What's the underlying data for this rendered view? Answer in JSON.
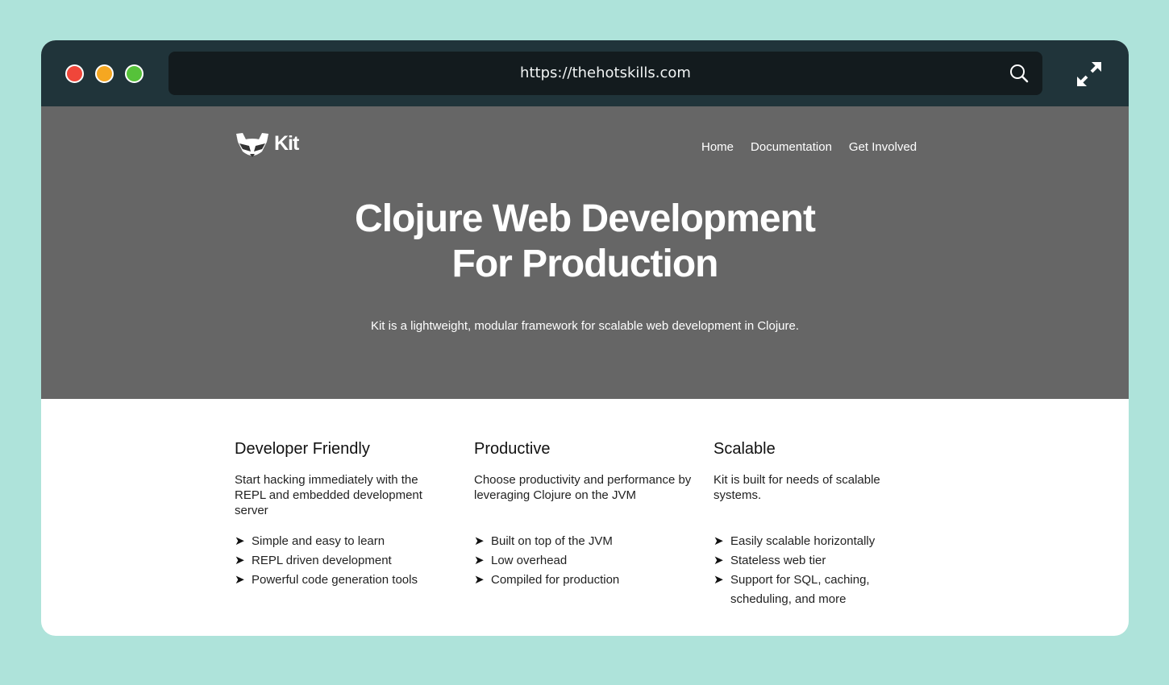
{
  "browser": {
    "url": "https://thehotskills.com",
    "icons": {
      "search": "search-icon",
      "expand": "expand-icon"
    },
    "colors": {
      "background": "#aee3da",
      "titlebar": "#20343a",
      "urlbar": "#131b1e",
      "close": "#f0463a",
      "minimize": "#f5a721",
      "maximize": "#56c23a"
    }
  },
  "site": {
    "logo_text": "Kit",
    "logo_icon": "raccoon-logo-icon",
    "nav": [
      {
        "label": "Home"
      },
      {
        "label": "Documentation"
      },
      {
        "label": "Get Involved"
      }
    ],
    "hero": {
      "title_line1": "Clojure Web Development",
      "title_line2": "For Production",
      "subtitle": "Kit is a lightweight, modular framework for scalable web development in Clojure.",
      "background": "#666666"
    },
    "features": [
      {
        "title": "Developer Friendly",
        "description": "Start hacking immediately with the REPL and embedded development server",
        "bullets": [
          "Simple and easy to learn",
          "REPL driven development",
          "Powerful code generation tools"
        ]
      },
      {
        "title": "Productive",
        "description": "Choose productivity and performance by leveraging Clojure on the JVM",
        "bullets": [
          "Built on top of the JVM",
          "Low overhead",
          "Compiled for production"
        ]
      },
      {
        "title": "Scalable",
        "description": "Kit is built for needs of scalable systems.",
        "bullets": [
          "Easily scalable horizontally",
          "Stateless web tier",
          "Support for SQL, caching, scheduling, and more"
        ]
      }
    ],
    "bullet_glyph": "➤"
  }
}
